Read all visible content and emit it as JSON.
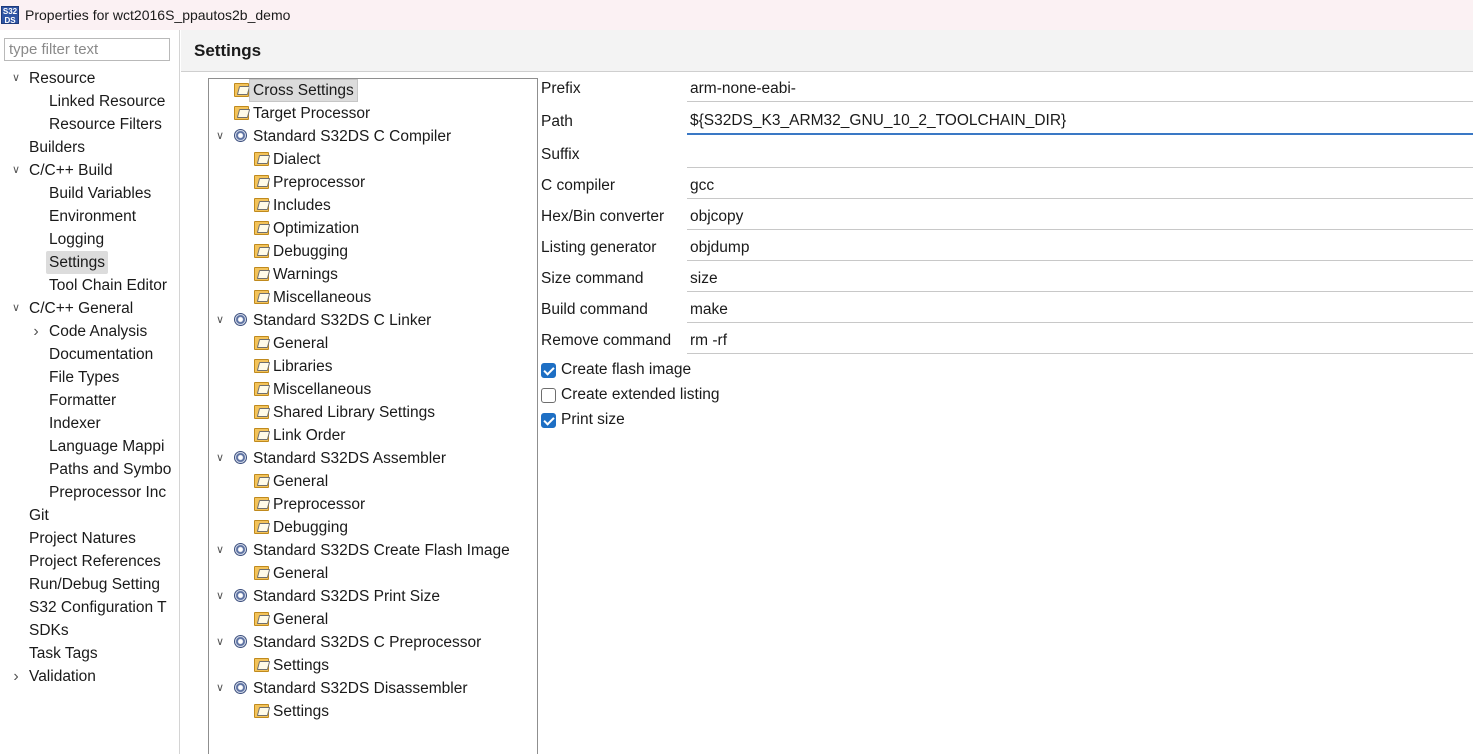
{
  "window": {
    "app_icon_text": "S32 DS",
    "title": "Properties for wct2016S_ppautos2b_demo"
  },
  "filter": {
    "placeholder": "type filter text",
    "value": ""
  },
  "nav": {
    "items": [
      {
        "label": "Resource",
        "expander": "expanded"
      },
      {
        "label": "Linked Resource"
      },
      {
        "label": "Resource Filters"
      },
      {
        "label": "Builders"
      },
      {
        "label": "C/C++ Build",
        "expander": "expanded"
      },
      {
        "label": "Build Variables"
      },
      {
        "label": "Environment"
      },
      {
        "label": "Logging"
      },
      {
        "label": "Settings",
        "selected": true
      },
      {
        "label": "Tool Chain Editor"
      },
      {
        "label": "C/C++ General",
        "expander": "expanded"
      },
      {
        "label": "Code Analysis",
        "expander": "collapsed"
      },
      {
        "label": "Documentation"
      },
      {
        "label": "File Types"
      },
      {
        "label": "Formatter"
      },
      {
        "label": "Indexer"
      },
      {
        "label": "Language Mappi"
      },
      {
        "label": "Paths and Symbo"
      },
      {
        "label": "Preprocessor Inc"
      },
      {
        "label": "Git"
      },
      {
        "label": "Project Natures"
      },
      {
        "label": "Project References"
      },
      {
        "label": "Run/Debug Setting"
      },
      {
        "label": "S32 Configuration T"
      },
      {
        "label": "SDKs"
      },
      {
        "label": "Task Tags"
      },
      {
        "label": "Validation",
        "expander": "collapsed"
      }
    ]
  },
  "panel": {
    "title": "Settings"
  },
  "settings_tree": {
    "items": [
      {
        "label": "Cross Settings",
        "icon": "folder-settings-icon",
        "selected": true
      },
      {
        "label": "Target Processor",
        "icon": "folder-settings-icon"
      },
      {
        "label": "Standard S32DS C Compiler",
        "icon": "tool-gear-icon",
        "expander": "expanded"
      },
      {
        "label": "Dialect",
        "icon": "folder-settings-icon"
      },
      {
        "label": "Preprocessor",
        "icon": "folder-settings-icon"
      },
      {
        "label": "Includes",
        "icon": "folder-settings-icon"
      },
      {
        "label": "Optimization",
        "icon": "folder-settings-icon"
      },
      {
        "label": "Debugging",
        "icon": "folder-settings-icon"
      },
      {
        "label": "Warnings",
        "icon": "folder-settings-icon"
      },
      {
        "label": "Miscellaneous",
        "icon": "folder-settings-icon"
      },
      {
        "label": "Standard S32DS C Linker",
        "icon": "tool-gear-icon",
        "expander": "expanded"
      },
      {
        "label": "General",
        "icon": "folder-settings-icon"
      },
      {
        "label": "Libraries",
        "icon": "folder-settings-icon"
      },
      {
        "label": "Miscellaneous",
        "icon": "folder-settings-icon"
      },
      {
        "label": "Shared Library Settings",
        "icon": "folder-settings-icon"
      },
      {
        "label": "Link Order",
        "icon": "folder-settings-icon"
      },
      {
        "label": "Standard S32DS Assembler",
        "icon": "tool-gear-icon",
        "expander": "expanded"
      },
      {
        "label": "General",
        "icon": "folder-settings-icon"
      },
      {
        "label": "Preprocessor",
        "icon": "folder-settings-icon"
      },
      {
        "label": "Debugging",
        "icon": "folder-settings-icon"
      },
      {
        "label": "Standard S32DS Create Flash Image",
        "icon": "tool-gear-icon",
        "expander": "expanded"
      },
      {
        "label": "General",
        "icon": "folder-settings-icon"
      },
      {
        "label": "Standard S32DS Print Size",
        "icon": "tool-gear-icon",
        "expander": "expanded"
      },
      {
        "label": "General",
        "icon": "folder-settings-icon"
      },
      {
        "label": "Standard S32DS C Preprocessor",
        "icon": "tool-gear-icon",
        "expander": "expanded"
      },
      {
        "label": "Settings",
        "icon": "folder-settings-icon"
      },
      {
        "label": "Standard S32DS Disassembler",
        "icon": "tool-gear-icon",
        "expander": "expanded"
      },
      {
        "label": "Settings",
        "icon": "folder-settings-icon"
      }
    ]
  },
  "cross_settings": {
    "fields": [
      {
        "label": "Prefix",
        "value": "arm-none-eabi-"
      },
      {
        "label": "Path",
        "value": "${S32DS_K3_ARM32_GNU_10_2_TOOLCHAIN_DIR}",
        "focused": true
      },
      {
        "label": "Suffix",
        "value": ""
      },
      {
        "label": "C compiler",
        "value": "gcc"
      },
      {
        "label": "Hex/Bin converter",
        "value": "objcopy"
      },
      {
        "label": "Listing generator",
        "value": "objdump"
      },
      {
        "label": "Size command",
        "value": "size"
      },
      {
        "label": "Build command",
        "value": "make"
      },
      {
        "label": "Remove command",
        "value": "rm -rf"
      }
    ],
    "checkboxes": [
      {
        "label": "Create flash image",
        "checked": true
      },
      {
        "label": "Create extended listing",
        "checked": false
      },
      {
        "label": "Print size",
        "checked": true
      }
    ]
  },
  "colors": {
    "titlebar_bg": "#fbf1f3",
    "selection_bg": "#dcdcdc",
    "checkbox_checked": "#1e6fc4",
    "focus_underline": "#3a78c5"
  }
}
